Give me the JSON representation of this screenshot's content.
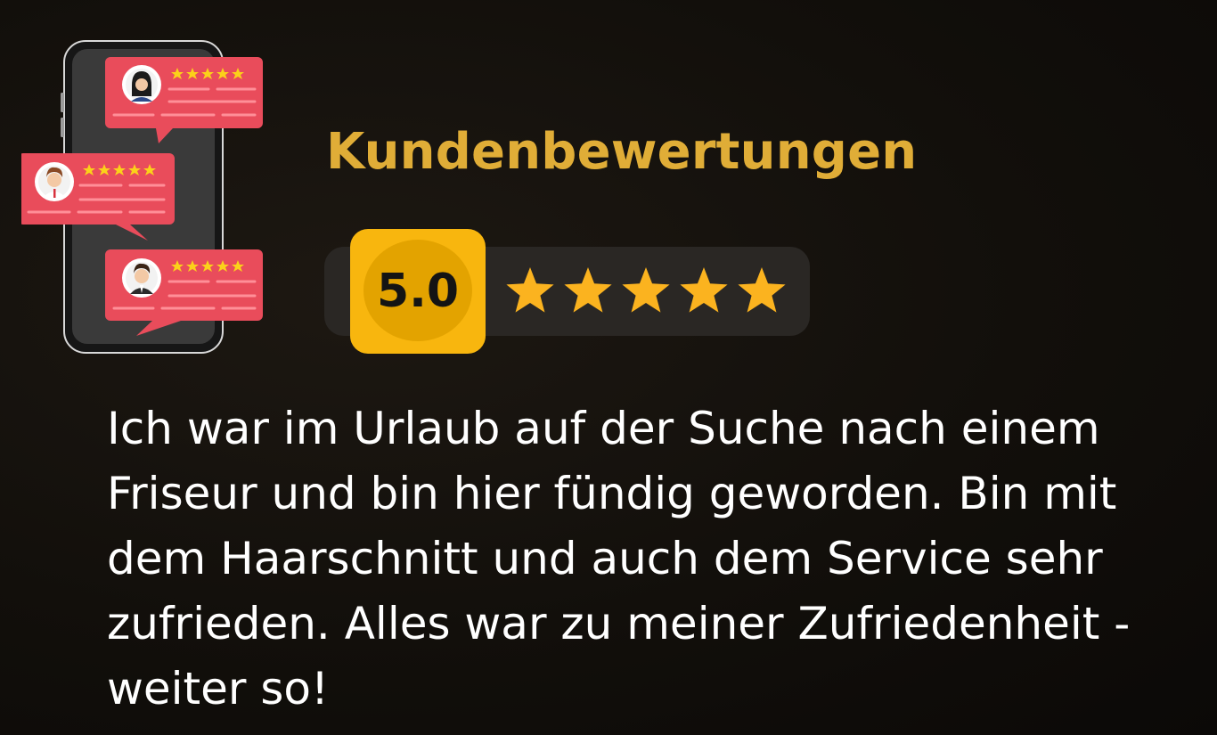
{
  "header": {
    "title": "Kundenbewertungen"
  },
  "rating": {
    "score": "5.0",
    "stars_filled": 5,
    "stars_max": 5
  },
  "review": {
    "text": "Ich war im Urlaub auf der Suche nach einem\nFriseur und bin hier fündig geworden. Bin mit\ndem Haarschnitt und auch dem Service sehr\nzufrieden. Alles war zu meiner Zufriedenheit -\nweiter so!"
  },
  "illustration": {
    "icon": "phone-reviews-icon",
    "cards": [
      {
        "avatar": "woman-avatar-icon",
        "stars": 5
      },
      {
        "avatar": "man-avatar-icon",
        "stars": 5
      },
      {
        "avatar": "man-avatar-icon",
        "stars": 5
      }
    ]
  },
  "colors": {
    "background": "#120f0b",
    "title": "#e0ad37",
    "badge": "#f8b60e",
    "badge_inner": "#e3a300",
    "pill": "#2a2724",
    "star": "#fbb31f",
    "card": "#e94c5b",
    "text": "#ffffff"
  }
}
